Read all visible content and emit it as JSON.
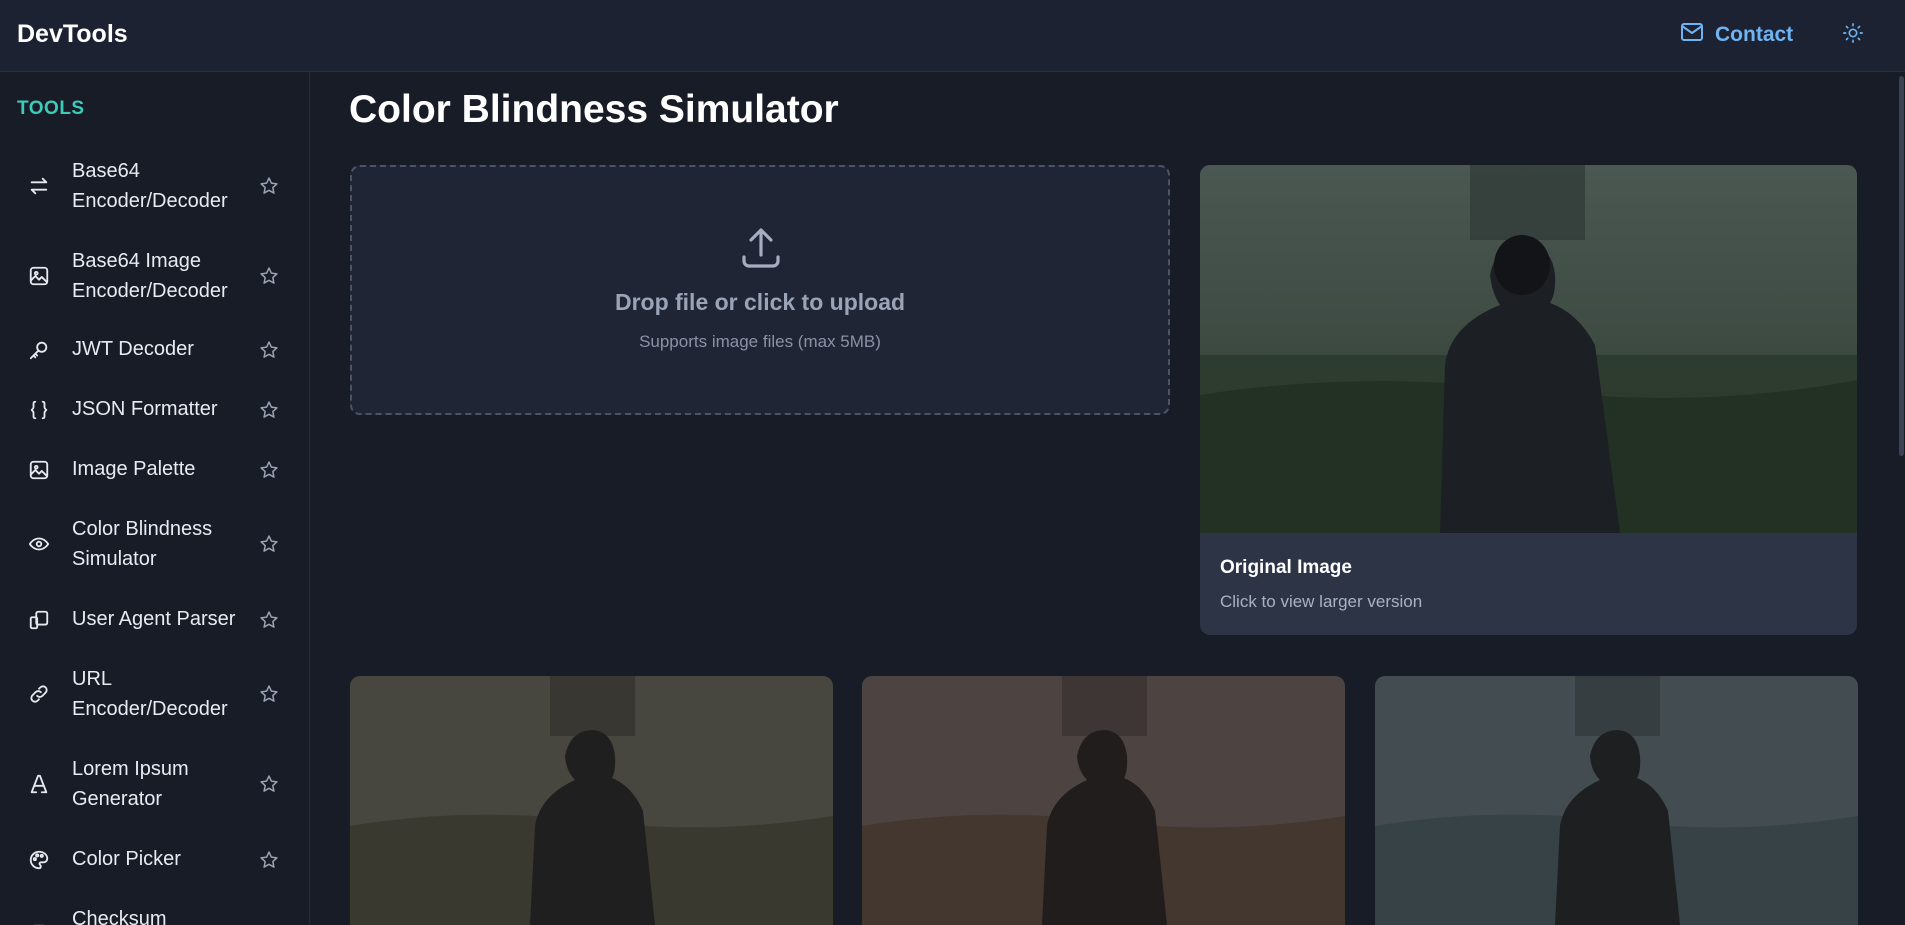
{
  "header": {
    "brand": "DevTools",
    "contact_label": "Contact",
    "contact_icon": "mail-icon",
    "theme_icon": "sun-icon"
  },
  "sidebar": {
    "heading": "TOOLS",
    "items": [
      {
        "label": "Base64 Encoder/Decoder",
        "icon": "arrows-exchange-icon"
      },
      {
        "label": "Base64 Image Encoder/Decoder",
        "icon": "image-icon"
      },
      {
        "label": "JWT Decoder",
        "icon": "key-icon"
      },
      {
        "label": "JSON Formatter",
        "icon": "braces-icon"
      },
      {
        "label": "Image Palette",
        "icon": "image-icon"
      },
      {
        "label": "Color Blindness Simulator",
        "icon": "eye-icon"
      },
      {
        "label": "User Agent Parser",
        "icon": "devices-icon"
      },
      {
        "label": "URL Encoder/Decoder",
        "icon": "link-icon"
      },
      {
        "label": "Lorem Ipsum Generator",
        "icon": "typography-icon"
      },
      {
        "label": "Color Picker",
        "icon": "palette-icon"
      },
      {
        "label": "Checksum",
        "icon": "file-icon"
      }
    ]
  },
  "main": {
    "title": "Color Blindness Simulator",
    "upload": {
      "title": "Drop file or click to upload",
      "subtitle": "Supports image files (max 5MB)"
    },
    "original": {
      "title": "Original Image",
      "subtitle": "Click to view larger version"
    }
  },
  "colors": {
    "background": "#181c26",
    "header": "#1c2231",
    "accent_teal": "#3ccbb8",
    "link_blue": "#6fb3f2",
    "card": "#2c3446"
  }
}
